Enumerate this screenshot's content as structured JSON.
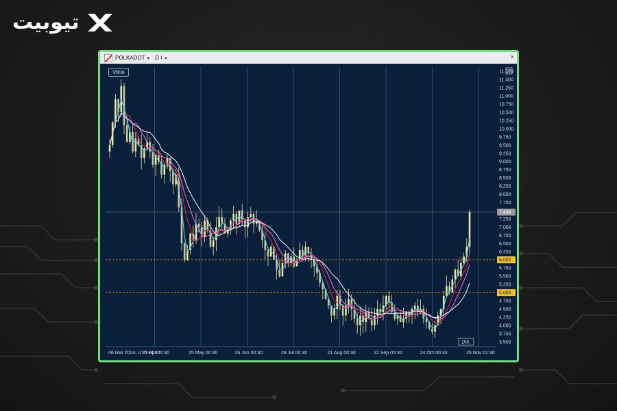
{
  "brand": {
    "logo_text": "تیوبیت"
  },
  "window": {
    "symbol": "POLKADOT",
    "period": "D",
    "period_sub": "1",
    "vline_button": "Vline",
    "close_glyph": "×",
    "edit_icon": "pencil-icon"
  },
  "colors": {
    "frame_border": "#6ee07a",
    "chart_bg": "#0a1f3a",
    "candle": "#e8e6a0",
    "ma_cyan": "#5fd0e0",
    "ma_red": "#e0203a",
    "ma_pink": "#e070d0",
    "ma_white": "#e8e8f0",
    "level_line": "#d9a53a",
    "level_label_bg": "#f2c230",
    "price_label_bg": "#9a9a9a"
  },
  "chart_data": {
    "type": "candlestick",
    "x_labels": [
      "06 Mar 2024, UTC+3:30",
      "23 Apr 00:30",
      "25 May 00:30",
      "26 Jun 00:30",
      "28 Jul 00:30",
      "21 Aug 00:30",
      "22 Sep 00:30",
      "24 Oct 00:30",
      "25 Nov 01:30"
    ],
    "y_ticks": [
      "11.75",
      "11.50",
      "11.25",
      "11.00",
      "10.75",
      "10.50",
      "10.25",
      "10.00",
      "9.75",
      "9.50",
      "9.25",
      "9.00",
      "8.75",
      "8.50",
      "8.25",
      "8.00",
      "7.75",
      "7.25",
      "7.00",
      "6.75",
      "6.50",
      "6.25",
      "5.75",
      "5.50",
      "5.25",
      "4.75",
      "4.50",
      "4.25",
      "4.00",
      "3.75",
      "3.50"
    ],
    "y_tick_suffix": "0",
    "ylim": [
      3.35,
      11.9
    ],
    "price_labels": {
      "current": "7.456",
      "level_upper": "6.000",
      "level_lower": "5.000"
    },
    "level_upper": 6.0,
    "level_lower": 5.0,
    "current_price": 7.456,
    "crosshair_badge": "15h",
    "close_series": [
      9.5,
      10.2,
      10.9,
      10.5,
      11.3,
      10.1,
      9.6,
      9.9,
      9.3,
      9.7,
      9.5,
      9.1,
      9.4,
      9.6,
      9.3,
      8.9,
      9.2,
      9.0,
      8.6,
      8.9,
      9.1,
      8.7,
      8.3,
      8.6,
      7.6,
      6.5,
      6.0,
      6.3,
      6.8,
      6.6,
      7.1,
      7.0,
      6.7,
      7.2,
      6.9,
      6.4,
      6.6,
      7.0,
      7.3,
      7.1,
      6.8,
      6.9,
      7.2,
      7.4,
      7.1,
      7.5,
      7.2,
      7.0,
      7.3,
      7.4,
      7.1,
      7.2,
      6.9,
      6.6,
      6.3,
      6.1,
      6.4,
      6.0,
      5.7,
      5.5,
      5.9,
      6.2,
      5.9,
      6.1,
      5.8,
      6.0,
      6.3,
      6.1,
      6.4,
      6.2,
      6.0,
      5.8,
      5.6,
      5.3,
      5.1,
      4.8,
      4.6,
      4.3,
      4.5,
      4.9,
      4.6,
      4.3,
      4.6,
      4.8,
      4.5,
      4.2,
      4.0,
      4.3,
      4.1,
      4.4,
      4.2,
      4.0,
      4.3,
      4.5,
      4.4,
      4.6,
      4.9,
      4.7,
      4.4,
      4.2,
      4.3,
      4.1,
      4.2,
      4.4,
      4.3,
      4.5,
      4.6,
      4.4,
      4.5,
      4.2,
      4.1,
      3.9,
      3.8,
      4.0,
      4.3,
      4.5,
      4.9,
      5.2,
      5.0,
      5.4,
      5.7,
      5.5,
      5.9,
      6.1,
      6.4,
      7.456
    ]
  }
}
